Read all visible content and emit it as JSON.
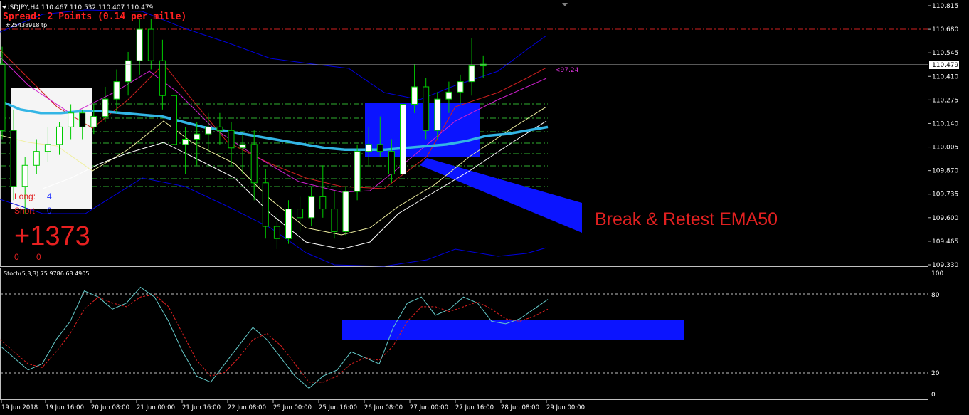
{
  "header": {
    "symbol_line": "USDJPY,H4  110.467 110.532 110.407 110.479",
    "spread_line": "Spread: 2 Points (0.14 per mille)",
    "order_line": "#25438918 tp"
  },
  "price_axis": {
    "ticks": [
      "110.815",
      "110.680",
      "110.545",
      "110.410",
      "110.275",
      "110.140",
      "110.005",
      "109.870",
      "109.735",
      "109.600",
      "109.465",
      "109.330"
    ],
    "current_price_label": "110.479"
  },
  "stoch_panel": {
    "title": "Stoch(5,3,3) 75.9786 68.4905",
    "ticks": [
      "100",
      "80",
      "20",
      "0"
    ]
  },
  "time_axis": {
    "labels": [
      "19 Jun 2018",
      "19 Jun 16:00",
      "20 Jun 08:00",
      "21 Jun 00:00",
      "21 Jun 16:00",
      "22 Jun 08:00",
      "25 Jun 00:00",
      "25 Jun 16:00",
      "26 Jun 08:00",
      "27 Jun 00:00",
      "27 Jun 16:00",
      "28 Jun 08:00",
      "29 Jun 00:00"
    ]
  },
  "stats_box": {
    "long_label": "Long:",
    "long_value": "4",
    "short_label": "Short",
    "short_value": "0",
    "profit": "+1373",
    "zero_a": "0",
    "zero_b": "0"
  },
  "annotations": {
    "pips_label": "<97.24",
    "break_retest": "Break & Retest EMA50"
  },
  "colors": {
    "background": "#000000",
    "bull_candle": "#ffffff",
    "bear_candle": "#000000",
    "wick": "#00cc00",
    "ema50": "#33b5e5",
    "bollinger": "#0000dd",
    "annotation_blue": "#0000ff",
    "annotation_text": "#e02020"
  },
  "chart_data": {
    "type": "candlestick",
    "symbol": "USDJPY",
    "timeframe": "H4",
    "last_ohlc": {
      "open": 110.467,
      "high": 110.532,
      "low": 110.407,
      "close": 110.479
    },
    "price_range": [
      109.33,
      110.815
    ],
    "candles": [
      [
        110.48,
        110.58,
        110.05,
        110.1
      ],
      [
        110.1,
        110.22,
        109.7,
        109.78
      ],
      [
        109.78,
        109.95,
        109.62,
        109.9
      ],
      [
        109.9,
        110.05,
        109.85,
        109.98
      ],
      [
        109.98,
        110.12,
        109.92,
        110.02
      ],
      [
        110.02,
        110.15,
        109.96,
        110.12
      ],
      [
        110.12,
        110.25,
        110.05,
        110.2
      ],
      [
        110.2,
        110.22,
        110.05,
        110.12
      ],
      [
        110.12,
        110.25,
        110.08,
        110.18
      ],
      [
        110.18,
        110.35,
        110.15,
        110.28
      ],
      [
        110.28,
        110.45,
        110.2,
        110.38
      ],
      [
        110.38,
        110.55,
        110.3,
        110.5
      ],
      [
        110.5,
        110.74,
        110.42,
        110.68
      ],
      [
        110.68,
        110.74,
        110.45,
        110.5
      ],
      [
        110.5,
        110.62,
        110.22,
        110.3
      ],
      [
        110.3,
        110.32,
        109.95,
        110.02
      ],
      [
        110.02,
        110.12,
        109.85,
        110.05
      ],
      [
        110.05,
        110.15,
        109.9,
        110.08
      ],
      [
        110.08,
        110.2,
        109.98,
        110.12
      ],
      [
        110.12,
        110.2,
        110.02,
        110.1
      ],
      [
        110.1,
        110.15,
        109.9,
        110.0
      ],
      [
        110.0,
        110.08,
        109.85,
        110.02
      ],
      [
        110.02,
        110.1,
        109.7,
        109.8
      ],
      [
        109.8,
        109.88,
        109.48,
        109.55
      ],
      [
        109.55,
        109.62,
        109.42,
        109.48
      ],
      [
        109.48,
        109.7,
        109.45,
        109.65
      ],
      [
        109.65,
        109.72,
        109.52,
        109.6
      ],
      [
        109.6,
        109.78,
        109.55,
        109.72
      ],
      [
        109.72,
        109.9,
        109.6,
        109.65
      ],
      [
        109.65,
        109.75,
        109.48,
        109.52
      ],
      [
        109.52,
        109.78,
        109.5,
        109.75
      ],
      [
        109.75,
        110.02,
        109.7,
        109.98
      ],
      [
        109.98,
        110.12,
        109.9,
        110.02
      ],
      [
        110.02,
        110.18,
        109.95,
        109.98
      ],
      [
        109.98,
        110.05,
        109.8,
        109.85
      ],
      [
        109.85,
        110.28,
        109.8,
        110.25
      ],
      [
        110.25,
        110.48,
        110.2,
        110.35
      ],
      [
        110.35,
        110.4,
        110.05,
        110.1
      ],
      [
        110.1,
        110.32,
        110.05,
        110.28
      ],
      [
        110.28,
        110.38,
        110.2,
        110.32
      ],
      [
        110.32,
        110.42,
        110.25,
        110.38
      ],
      [
        110.38,
        110.63,
        110.3,
        110.47
      ],
      [
        110.47,
        110.53,
        110.4,
        110.48
      ]
    ],
    "ema50": [
      110.27,
      110.22,
      110.2,
      110.2,
      110.21,
      110.21,
      110.2,
      110.19,
      110.18,
      110.15,
      110.12,
      110.1,
      110.08,
      110.06,
      110.04,
      110.02,
      110.0,
      109.99,
      109.99,
      109.99,
      110.0,
      110.01,
      110.02,
      110.04,
      110.07,
      110.08,
      110.1,
      110.12
    ],
    "stochastic": {
      "params": "5,3,3",
      "main_last": 75.9786,
      "signal_last": 68.4905,
      "main": [
        40,
        30,
        20,
        25,
        45,
        60,
        85,
        80,
        70,
        75,
        88,
        80,
        60,
        35,
        15,
        10,
        25,
        40,
        55,
        45,
        30,
        15,
        5,
        15,
        20,
        35,
        30,
        25,
        55,
        75,
        80,
        65,
        70,
        80,
        75,
        60,
        58,
        62,
        70,
        78
      ],
      "signal": [
        45,
        35,
        25,
        22,
        35,
        50,
        70,
        80,
        75,
        72,
        80,
        82,
        72,
        50,
        28,
        15,
        18,
        30,
        45,
        50,
        40,
        25,
        10,
        10,
        15,
        25,
        30,
        28,
        40,
        60,
        72,
        72,
        68,
        72,
        76,
        70,
        62,
        60,
        64,
        70
      ]
    },
    "levels": {
      "upper": 80,
      "lower": 20
    }
  }
}
